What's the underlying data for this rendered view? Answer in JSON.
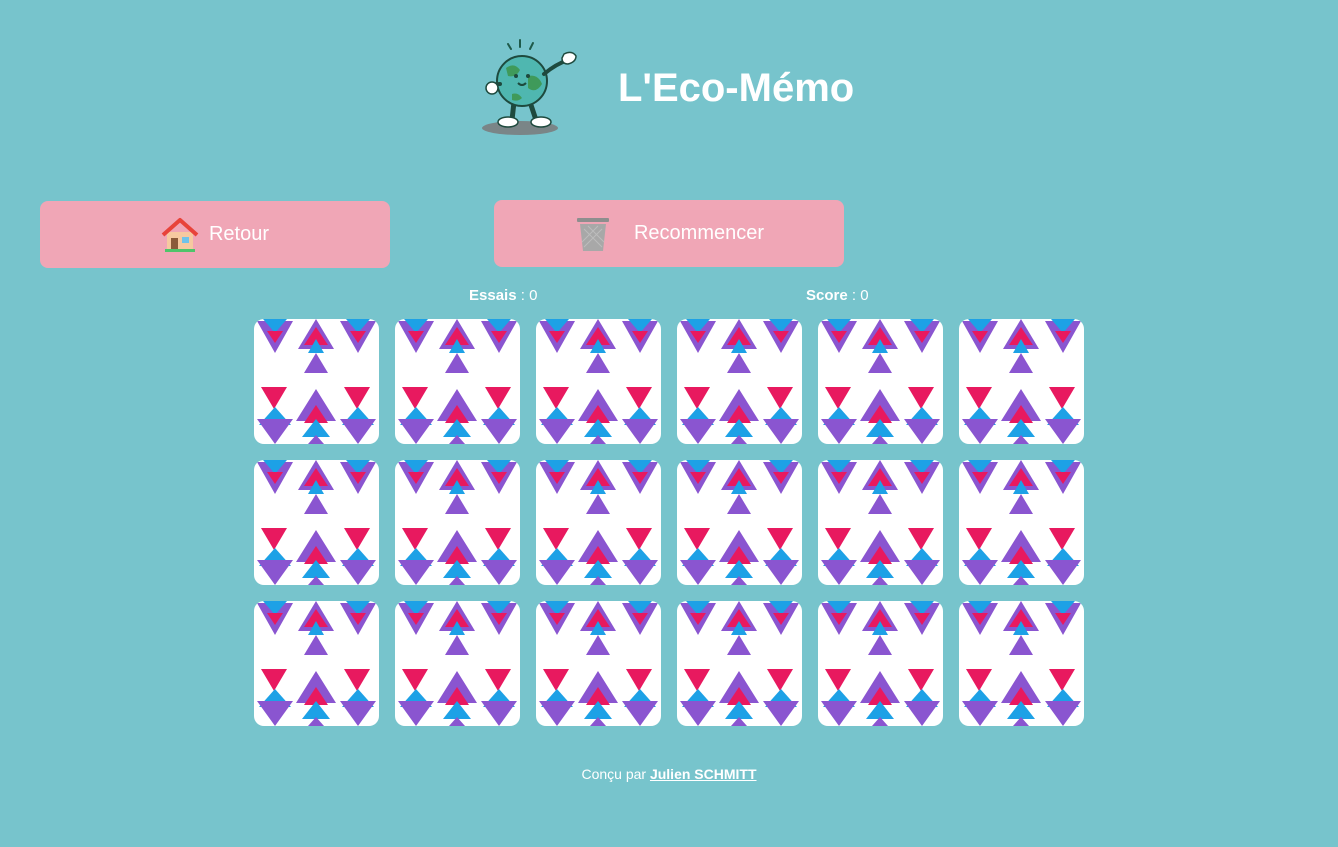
{
  "header": {
    "title": "L'Eco-Mémo",
    "mascot_icon": "earth-mascot-icon"
  },
  "buttons": {
    "back_label": "Retour",
    "back_icon": "house-icon",
    "restart_label": "Recommencer",
    "restart_icon": "trash-bin-icon"
  },
  "stats": {
    "tries_label": "Essais",
    "tries_value": "0",
    "score_label": "Score",
    "score_value": "0"
  },
  "board": {
    "rows": 3,
    "columns": 6,
    "card_state": "face-down",
    "card_back_pattern": "triangles",
    "card_back_colors": [
      "#e8195f",
      "#1da1e6",
      "#8a55d0"
    ]
  },
  "footer": {
    "prefix": "Conçu par",
    "author": "Julien SCHMITT"
  },
  "colors": {
    "background": "#77c4cc",
    "button": "#f0a6b6",
    "card": "#ffffff"
  }
}
